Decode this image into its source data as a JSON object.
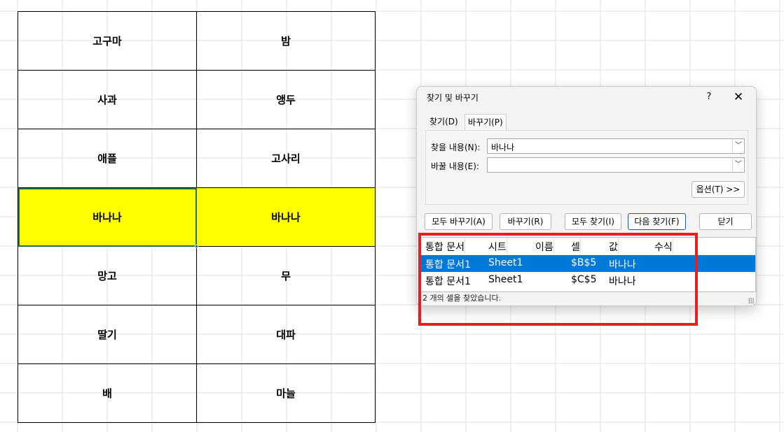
{
  "sheet": {
    "rows": [
      [
        "고구마",
        "밤"
      ],
      [
        "사과",
        "앵두"
      ],
      [
        "애플",
        "고사리"
      ],
      [
        "바나나",
        "바나나"
      ],
      [
        "망고",
        "무"
      ],
      [
        "딸기",
        "대파"
      ],
      [
        "배",
        "마늘"
      ]
    ],
    "highlight_color": "#ffff00",
    "selection_color": "#217346"
  },
  "dialog": {
    "title": "찾기 및 바꾸기",
    "help": "?",
    "close": "✕",
    "tabs": [
      "찾기(D)",
      "바꾸기(P)"
    ],
    "active_tab": "바꾸기(P)",
    "find_label": "찾을 내용(N):",
    "find_value": "바나나",
    "replace_label": "바꿀 내용(E):",
    "replace_value": "",
    "options_button": "옵션(T) >>",
    "buttons": {
      "replace_all": "모두 바꾸기(A)",
      "replace": "바꾸기(R)",
      "find_all": "모두 찾기(I)",
      "find_next": "다음 찾기(F)",
      "close": "닫기"
    },
    "results": {
      "columns": [
        "통합 문서",
        "시트",
        "이름",
        "셀",
        "값",
        "수식"
      ],
      "rows": [
        [
          "통합 문서1",
          "Sheet1",
          "",
          "$B$5",
          "바나나",
          ""
        ],
        [
          "통합 문서1",
          "Sheet1",
          "",
          "$C$5",
          "바나나",
          ""
        ]
      ],
      "selected_row": 0,
      "selection_color": "#0078d7"
    },
    "status": "2 개의 셀을 찾았습니다."
  },
  "annotation_color": "#e81e25"
}
